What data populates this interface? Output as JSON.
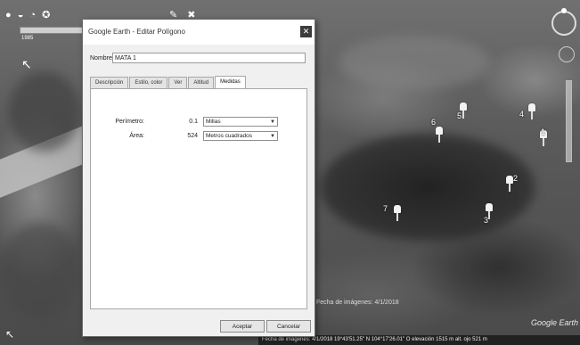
{
  "map": {
    "top_toolbar_left": "● ◒ ◔ ✪",
    "top_toolbar_right": "✎ ✖",
    "time_slider_label": "1985",
    "watermark": "Google Earth",
    "imagery_credit": "Fecha de imágenes: 4/1/2018",
    "status_bar": "Fecha de imágenes: 4/1/2018  19°43'51.25\" N  104°17'26.01\" O  elevación  1515 m  alt. ojo  521 m",
    "placemarks": [
      {
        "label": "6"
      },
      {
        "label": "5"
      },
      {
        "label": "4"
      },
      {
        "label": "1"
      },
      {
        "label": "2"
      },
      {
        "label": "7"
      },
      {
        "label": "3"
      }
    ]
  },
  "dialog": {
    "title": "Google Earth - Editar Polígono",
    "close_symbol": "✕",
    "name_label": "Nombre:",
    "name_value": "MATA 1",
    "tabs": [
      {
        "label": "Descripción",
        "active": false
      },
      {
        "label": "Estilo, color",
        "active": false
      },
      {
        "label": "Ver",
        "active": false
      },
      {
        "label": "Altitud",
        "active": false
      },
      {
        "label": "Medidas",
        "active": true
      }
    ],
    "measurements": {
      "perimeter_label": "Perímetro:",
      "perimeter_value": "0.1",
      "perimeter_unit": "Millas",
      "area_label": "Área:",
      "area_value": "524",
      "area_unit": "Metros cuadrados"
    },
    "accept_label": "Aceptar",
    "cancel_label": "Cancelar"
  }
}
